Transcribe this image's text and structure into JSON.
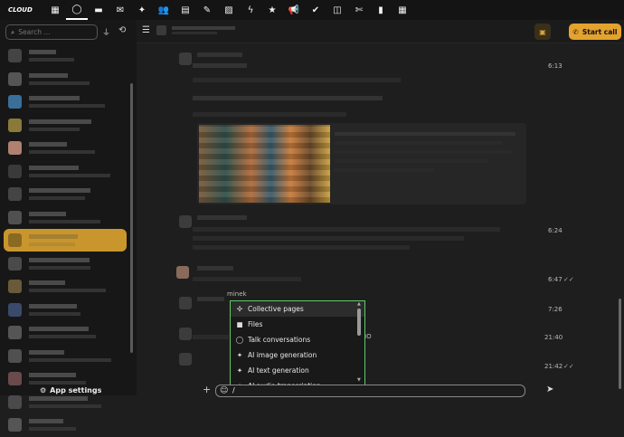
{
  "topbar": {
    "logo": "CLOUD",
    "icons": [
      "dashboard-icon",
      "search-icon",
      "files-icon",
      "mail-icon",
      "ai-icon",
      "contacts-icon",
      "calendar-icon",
      "notes-icon",
      "photos-icon",
      "activity-icon",
      "favorites-icon",
      "announcements-icon",
      "tasks-icon",
      "security-icon",
      "food-icon",
      "analytics-icon",
      "spreadsheet-icon"
    ],
    "icon_glyphs": [
      "▦",
      "◯",
      "▬",
      "✉",
      "✦",
      "👥",
      "▤",
      "✎",
      "▨",
      "ϟ",
      "★",
      "📢",
      "✔",
      "◫",
      "✄",
      "▮",
      "▦"
    ]
  },
  "sidebar": {
    "search_placeholder": "Search ...",
    "app_settings": "App settings",
    "selected_index": 8,
    "conversation_count": 17
  },
  "header": {
    "start_call": "Start call"
  },
  "messages": {
    "timestamps": [
      "6:13",
      "6:24",
      "6:47",
      "7:26",
      "21:40",
      "21:42"
    ],
    "mention_fragment": "minek",
    "trailing_fragment": "IO"
  },
  "autocomplete": {
    "items": [
      {
        "label": "Collective pages",
        "icon": "collectives-icon",
        "glyph": "✣"
      },
      {
        "label": "Files",
        "icon": "folder-icon",
        "glyph": "■"
      },
      {
        "label": "Talk conversations",
        "icon": "talk-icon",
        "glyph": "◯"
      },
      {
        "label": "AI image generation",
        "icon": "ai-image-icon",
        "glyph": "✦"
      },
      {
        "label": "AI text generation",
        "icon": "ai-text-icon",
        "glyph": "✦"
      },
      {
        "label": "AI audio transcription",
        "icon": "ai-audio-icon",
        "glyph": "✦"
      }
    ]
  },
  "composer": {
    "value": "/"
  },
  "colors": {
    "accent": "#e4a22e",
    "selected_conversation": "#c9962e",
    "popup_border": "#5fcc68"
  }
}
